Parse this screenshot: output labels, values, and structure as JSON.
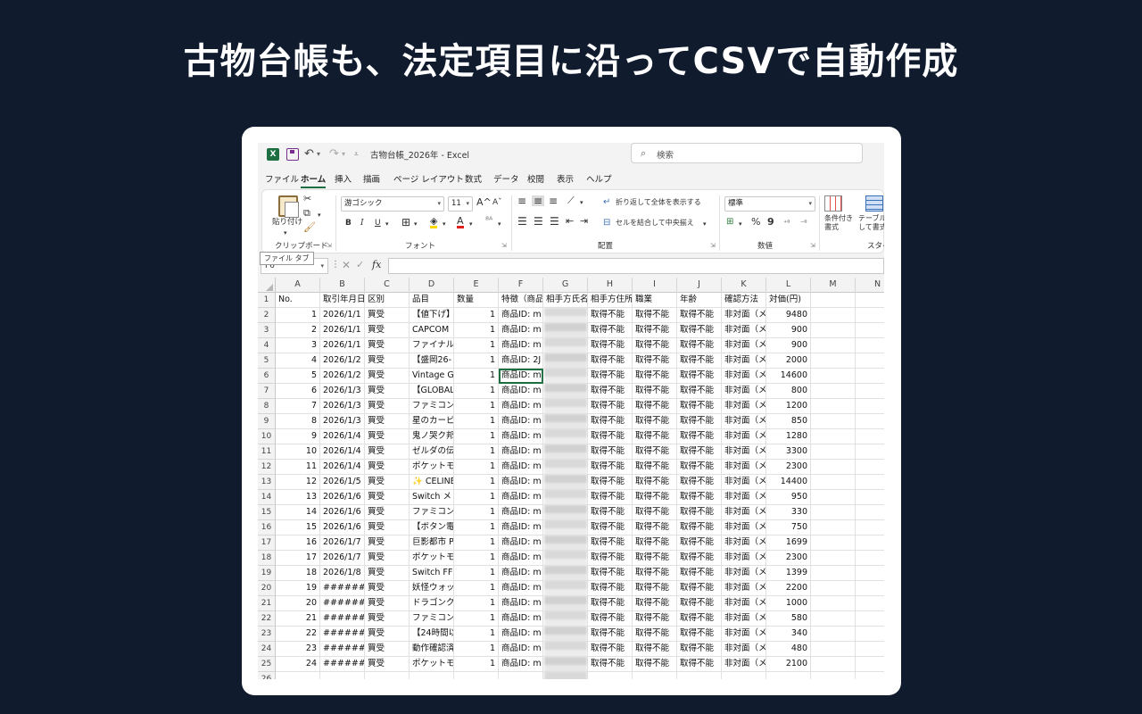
{
  "headline": "古物台帳も、法定項目に沿ってCSVで自動作成",
  "excel": {
    "app_logo": "X",
    "doc_title": "古物台帳_2026年  -  Excel",
    "search_placeholder": "検索",
    "menu_tabs": [
      "ファイル",
      "ホーム",
      "挿入",
      "描画",
      "ページ レイアウト",
      "数式",
      "データ",
      "校閲",
      "表示",
      "ヘルプ"
    ],
    "active_tab": "ホーム",
    "ribbon": {
      "clipboard": {
        "paste_label": "貼り付け",
        "group_label": "クリップボード"
      },
      "font": {
        "font_name": "游ゴシック",
        "font_size": "11",
        "grow": "A^",
        "shrink": "Aˇ",
        "bold": "B",
        "italic": "I",
        "underline": "U",
        "group_label": "フォント"
      },
      "alignment": {
        "wrap_label": "折り返して全体を表示する",
        "merge_label": "セルを結合して中央揃え",
        "group_label": "配置"
      },
      "number": {
        "format": "標準",
        "percent": "%",
        "comma": "9",
        "group_label": "数値"
      },
      "styles": {
        "conditional_label": "条件付き書式",
        "table_label": "テーブルとして書式設定",
        "group_label": "スタイル"
      }
    },
    "tooltip": "ファイル タブ",
    "name_box": "F6",
    "columns": [
      "A",
      "B",
      "C",
      "D",
      "E",
      "F",
      "G",
      "H",
      "I",
      "J",
      "K",
      "L",
      "M",
      "N"
    ],
    "header_row": [
      "No.",
      "取引年月日",
      "区別",
      "品目",
      "数量",
      "特徴（商品",
      "相手方氏名",
      "相手方住所",
      "職業",
      "年齢",
      "確認方法",
      "対価(円)",
      "",
      ""
    ],
    "rows": [
      [
        "1",
        "2026/1/1",
        "買受",
        "【値下げ】",
        "1",
        "商品ID: m",
        "",
        "取得不能",
        "取得不能",
        "取得不能",
        "非対面（メ",
        "9480"
      ],
      [
        "2",
        "2026/1/1",
        "買受",
        "CAPCOM",
        "1",
        "商品ID: m",
        "",
        "取得不能",
        "取得不能",
        "取得不能",
        "非対面（メ",
        "900"
      ],
      [
        "3",
        "2026/1/1",
        "買受",
        "ファイナル",
        "1",
        "商品ID: m",
        "",
        "取得不能",
        "取得不能",
        "取得不能",
        "非対面（メ",
        "900"
      ],
      [
        "4",
        "2026/1/2",
        "買受",
        "【盛岡26-",
        "1",
        "商品ID: 2J",
        "",
        "取得不能",
        "取得不能",
        "取得不能",
        "非対面（メ",
        "2000"
      ],
      [
        "5",
        "2026/1/2",
        "買受",
        "Vintage GU",
        "1",
        "商品ID: m",
        "",
        "取得不能",
        "取得不能",
        "取得不能",
        "非対面（メ",
        "14600"
      ],
      [
        "6",
        "2026/1/3",
        "買受",
        "【GLOBAL",
        "1",
        "商品ID: m",
        "",
        "取得不能",
        "取得不能",
        "取得不能",
        "非対面（メ",
        "800"
      ],
      [
        "7",
        "2026/1/3",
        "買受",
        "ファミコン",
        "1",
        "商品ID: m",
        "",
        "取得不能",
        "取得不能",
        "取得不能",
        "非対面（メ",
        "1200"
      ],
      [
        "8",
        "2026/1/3",
        "買受",
        "星のカービ",
        "1",
        "商品ID: m",
        "",
        "取得不能",
        "取得不能",
        "取得不能",
        "非対面（メ",
        "850"
      ],
      [
        "9",
        "2026/1/4",
        "買受",
        "鬼ノ哭ク邦",
        "1",
        "商品ID: m",
        "",
        "取得不能",
        "取得不能",
        "取得不能",
        "非対面（メ",
        "1280"
      ],
      [
        "10",
        "2026/1/4",
        "買受",
        "ゼルダの伝",
        "1",
        "商品ID: m",
        "",
        "取得不能",
        "取得不能",
        "取得不能",
        "非対面（メ",
        "3300"
      ],
      [
        "11",
        "2026/1/4",
        "買受",
        "ポケットモ",
        "1",
        "商品ID: m",
        "",
        "取得不能",
        "取得不能",
        "取得不能",
        "非対面（メ",
        "2300"
      ],
      [
        "12",
        "2026/1/5",
        "買受",
        "✨ CELINE",
        "1",
        "商品ID: m",
        "",
        "取得不能",
        "取得不能",
        "取得不能",
        "非対面（メ",
        "14400"
      ],
      [
        "13",
        "2026/1/6",
        "買受",
        "Switch メ",
        "1",
        "商品ID: m",
        "",
        "取得不能",
        "取得不能",
        "取得不能",
        "非対面（メ",
        "950"
      ],
      [
        "14",
        "2026/1/6",
        "買受",
        "ファミコン",
        "1",
        "商品ID: m",
        "",
        "取得不能",
        "取得不能",
        "取得不能",
        "非対面（メ",
        "330"
      ],
      [
        "15",
        "2026/1/6",
        "買受",
        "【ボタン電",
        "1",
        "商品ID: m",
        "",
        "取得不能",
        "取得不能",
        "取得不能",
        "非対面（メ",
        "750"
      ],
      [
        "16",
        "2026/1/7",
        "買受",
        "巨影都市 P",
        "1",
        "商品ID: m",
        "",
        "取得不能",
        "取得不能",
        "取得不能",
        "非対面（メ",
        "1699"
      ],
      [
        "17",
        "2026/1/7",
        "買受",
        "ポケットモ",
        "1",
        "商品ID: m",
        "",
        "取得不能",
        "取得不能",
        "取得不能",
        "非対面（メ",
        "2300"
      ],
      [
        "18",
        "2026/1/8",
        "買受",
        "Switch FF",
        "1",
        "商品ID: m",
        "",
        "取得不能",
        "取得不能",
        "取得不能",
        "非対面（メ",
        "1399"
      ],
      [
        "19",
        "########",
        "買受",
        "妖怪ウォッ",
        "1",
        "商品ID: m",
        "",
        "取得不能",
        "取得不能",
        "取得不能",
        "非対面（メ",
        "2200"
      ],
      [
        "20",
        "########",
        "買受",
        "ドラゴンク",
        "1",
        "商品ID: m",
        "",
        "取得不能",
        "取得不能",
        "取得不能",
        "非対面（メ",
        "1000"
      ],
      [
        "21",
        "########",
        "買受",
        "ファミコン",
        "1",
        "商品ID: m",
        "",
        "取得不能",
        "取得不能",
        "取得不能",
        "非対面（メ",
        "580"
      ],
      [
        "22",
        "########",
        "買受",
        "【24時間以",
        "1",
        "商品ID: m",
        "",
        "取得不能",
        "取得不能",
        "取得不能",
        "非対面（メ",
        "340"
      ],
      [
        "23",
        "########",
        "買受",
        "動作確認済",
        "1",
        "商品ID: m",
        "",
        "取得不能",
        "取得不能",
        "取得不能",
        "非対面（メ",
        "480"
      ],
      [
        "24",
        "########",
        "買受",
        "ポケットモ",
        "1",
        "商品ID: m",
        "",
        "取得不能",
        "取得不能",
        "取得不能",
        "非対面（メ",
        "2100"
      ]
    ]
  }
}
